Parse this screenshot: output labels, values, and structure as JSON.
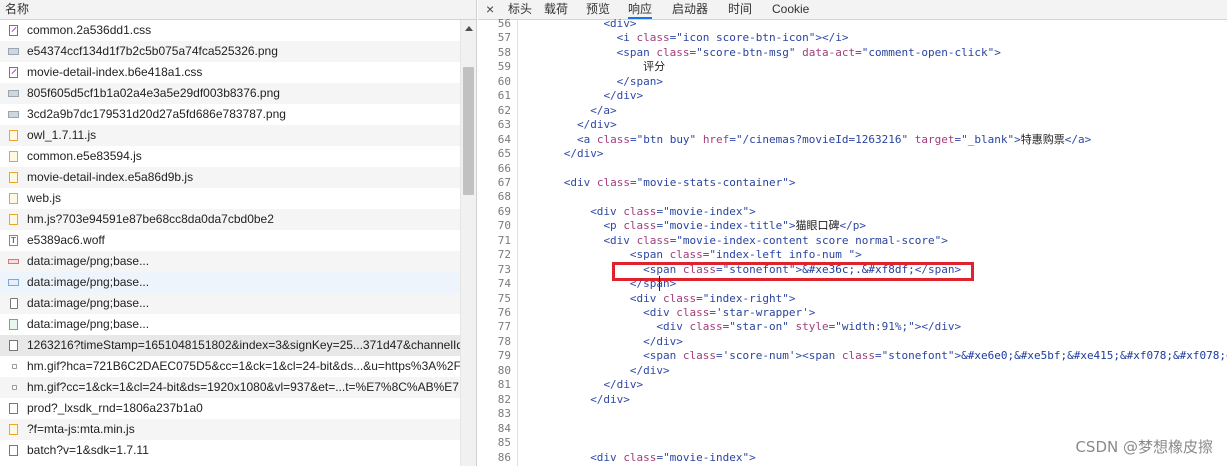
{
  "left_panel": {
    "header": "名称",
    "rows": [
      {
        "icon": "css",
        "name": "common.2a536dd1.css"
      },
      {
        "icon": "img",
        "name": "e54374ccf134d1f7b2c5b075a74fca525326.png"
      },
      {
        "icon": "css",
        "name": "movie-detail-index.b6e418a1.css"
      },
      {
        "icon": "img",
        "name": "805f605d5cf1b1a02a4e3a5e29df003b8376.png"
      },
      {
        "icon": "img",
        "name": "3cd2a9b7dc179531d20d27a5fd686e783787.png"
      },
      {
        "icon": "js",
        "name": "owl_1.7.11.js"
      },
      {
        "icon": "js",
        "name": "common.e5e83594.js"
      },
      {
        "icon": "js",
        "name": "movie-detail-index.e5a86d9b.js"
      },
      {
        "icon": "js",
        "name": "web.js"
      },
      {
        "icon": "js",
        "name": "hm.js?703e94591e87be68cc8da0da7cbd0be2"
      },
      {
        "icon": "font",
        "name": "e5389ac6.woff"
      },
      {
        "icon": "data-red",
        "name": "data:image/png;base..."
      },
      {
        "icon": "data-blue",
        "name": "data:image/png;base..."
      },
      {
        "icon": "phone",
        "name": "data:image/png;base..."
      },
      {
        "icon": "green",
        "name": "data:image/png;base..."
      },
      {
        "icon": "doc",
        "name": "1263216?timeStamp=1651048151802&index=3&signKey=25...371d47&channelId"
      },
      {
        "icon": "dot",
        "name": "hm.gif?hca=721B6C2DAEC075D5&cc=1&ck=1&cl=24-bit&ds...&u=https%3A%2F"
      },
      {
        "icon": "dot",
        "name": "hm.gif?cc=1&ck=1&cl=24-bit&ds=1920x1080&vl=937&et=...t=%E7%8C%AB%E7"
      },
      {
        "icon": "doc",
        "name": "prod?_lxsdk_rnd=1806a237b1a0"
      },
      {
        "icon": "js",
        "name": "?f=mta-js:mta.min.js"
      },
      {
        "icon": "doc",
        "name": "batch?v=1&sdk=1.7.11"
      }
    ]
  },
  "tabs": {
    "close": "×",
    "items": [
      "标头",
      "载荷",
      "预览",
      "响应",
      "启动器",
      "时间",
      "Cookie"
    ],
    "active": "响应"
  },
  "code_lines": [
    {
      "n": "56",
      "indent": 6,
      "html": "<span class=\"tg\">&lt;div&gt;</span>"
    },
    {
      "n": "57",
      "indent": 7,
      "html": "<span class=\"tg\">&lt;i </span><span class=\"an\">class</span><span class=\"tg\">=</span><span class=\"av\">\"icon score-btn-icon\"</span><span class=\"tg\">&gt;&lt;/i&gt;</span>"
    },
    {
      "n": "58",
      "indent": 7,
      "html": "<span class=\"tg\">&lt;span </span><span class=\"an\">class</span><span class=\"tg\">=</span><span class=\"av\">\"score-btn-msg\"</span> <span class=\"an\">data-act</span><span class=\"tg\">=</span><span class=\"av\">\"comment-open-click\"</span><span class=\"tg\">&gt;</span>"
    },
    {
      "n": "59",
      "indent": 9,
      "html": "<span class=\"tx\">评分</span>"
    },
    {
      "n": "60",
      "indent": 7,
      "html": "<span class=\"tg\">&lt;/span&gt;</span>"
    },
    {
      "n": "61",
      "indent": 6,
      "html": "<span class=\"tg\">&lt;/div&gt;</span>"
    },
    {
      "n": "62",
      "indent": 5,
      "html": "<span class=\"tg\">&lt;/a&gt;</span>"
    },
    {
      "n": "63",
      "indent": 4,
      "html": "<span class=\"tg\">&lt;/div&gt;</span>"
    },
    {
      "n": "64",
      "indent": 4,
      "html": "<span class=\"tg\">&lt;a </span><span class=\"an\">class</span><span class=\"tg\">=</span><span class=\"av\">\"btn buy\"</span> <span class=\"an\">href</span><span class=\"tg\">=</span><span class=\"av\">\"/cinemas?movieId=1263216\"</span> <span class=\"an\">target</span><span class=\"tg\">=</span><span class=\"av\">\"_blank\"</span><span class=\"tg\">&gt;</span><span class=\"tx\">特惠购票</span><span class=\"tg\">&lt;/a&gt;</span>"
    },
    {
      "n": "65",
      "indent": 3,
      "html": "<span class=\"tg\">&lt;/div&gt;</span>"
    },
    {
      "n": "66",
      "indent": 0,
      "html": ""
    },
    {
      "n": "67",
      "indent": 3,
      "html": "<span class=\"tg\">&lt;div </span><span class=\"an\">class</span><span class=\"tg\">=</span><span class=\"av\">\"movie-stats-container\"</span><span class=\"tg\">&gt;</span>"
    },
    {
      "n": "68",
      "indent": 0,
      "html": ""
    },
    {
      "n": "69",
      "indent": 5,
      "html": "<span class=\"tg\">&lt;div </span><span class=\"an\">class</span><span class=\"tg\">=</span><span class=\"av\">\"movie-index\"</span><span class=\"tg\">&gt;</span>"
    },
    {
      "n": "70",
      "indent": 6,
      "html": "<span class=\"tg\">&lt;p </span><span class=\"an\">class</span><span class=\"tg\">=</span><span class=\"av\">\"movie-index-title\"</span><span class=\"tg\">&gt;</span><span class=\"tx\">猫眼口碑</span><span class=\"tg\">&lt;/p&gt;</span>"
    },
    {
      "n": "71",
      "indent": 6,
      "html": "<span class=\"tg\">&lt;div </span><span class=\"an\">class</span><span class=\"tg\">=</span><span class=\"av\">\"movie-index-content score normal-score\"</span><span class=\"tg\">&gt;</span>"
    },
    {
      "n": "72",
      "indent": 8,
      "html": "<span class=\"tg\">&lt;span </span><span class=\"an\">class</span><span class=\"tg\">=</span><span class=\"av\">\"index-left info-num \"</span><span class=\"tg\">&gt;</span>"
    },
    {
      "n": "73",
      "indent": 9,
      "html": "<span class=\"tg\">&lt;span </span><span class=\"an\">class</span><span class=\"tg\">=</span><span class=\"av\">\"stonefont\"</span><span class=\"tg\">&gt;</span><span class=\"av2\">&amp;#xe36c;.&amp;#xf8df;</span><span class=\"tg\">&lt;/span&gt;</span>"
    },
    {
      "n": "74",
      "indent": 8,
      "html": "<span class=\"tg\">&lt;/span&gt;</span>"
    },
    {
      "n": "75",
      "indent": 8,
      "html": "<span class=\"tg\">&lt;div </span><span class=\"an\">class</span><span class=\"tg\">=</span><span class=\"av\">\"index-right\"</span><span class=\"tg\">&gt;</span>"
    },
    {
      "n": "76",
      "indent": 9,
      "html": "<span class=\"tg\">&lt;div </span><span class=\"an\">class</span><span class=\"tg\">=</span><span class=\"av\">'star-wrapper'</span><span class=\"tg\">&gt;</span>"
    },
    {
      "n": "77",
      "indent": 10,
      "html": "<span class=\"tg\">&lt;div </span><span class=\"an\">class</span><span class=\"tg\">=</span><span class=\"av\">\"star-on\"</span> <span class=\"an\">style</span><span class=\"tg\">=</span><span class=\"av\">\"width:91%;\"</span><span class=\"tg\">&gt;&lt;/div&gt;</span>"
    },
    {
      "n": "78",
      "indent": 9,
      "html": "<span class=\"tg\">&lt;/div&gt;</span>"
    },
    {
      "n": "79",
      "indent": 9,
      "html": "<span class=\"tg\">&lt;span </span><span class=\"an\">class</span><span class=\"tg\">=</span><span class=\"av\">'score-num'</span><span class=\"tg\">&gt;&lt;span </span><span class=\"an\">class</span><span class=\"tg\">=</span><span class=\"av\">\"stonefont\"</span><span class=\"tg\">&gt;</span><span class=\"av2\">&amp;#xe6e0;&amp;#xe5bf;&amp;#xe415;&amp;#xf078;&amp;#xf078;</span><span class=\"tg\">&lt;/</span>"
    },
    {
      "n": "80",
      "indent": 8,
      "html": "<span class=\"tg\">&lt;/div&gt;</span>"
    },
    {
      "n": "81",
      "indent": 6,
      "html": "<span class=\"tg\">&lt;/div&gt;</span>"
    },
    {
      "n": "82",
      "indent": 5,
      "html": "<span class=\"tg\">&lt;/div&gt;</span>"
    },
    {
      "n": "83",
      "indent": 0,
      "html": ""
    },
    {
      "n": "84",
      "indent": 0,
      "html": ""
    },
    {
      "n": "85",
      "indent": 0,
      "html": ""
    },
    {
      "n": "86",
      "indent": 5,
      "html": "<span class=\"tg\">&lt;div </span><span class=\"an\">class</span><span class=\"tg\">=</span><span class=\"av\">\"movie-index\"</span><span class=\"tg\">&gt;</span>"
    }
  ],
  "watermark": "CSDN @梦想橡皮擦",
  "colors": {
    "highlight_box": "#e0222c",
    "active_tab_underline": "#1a73e8"
  }
}
